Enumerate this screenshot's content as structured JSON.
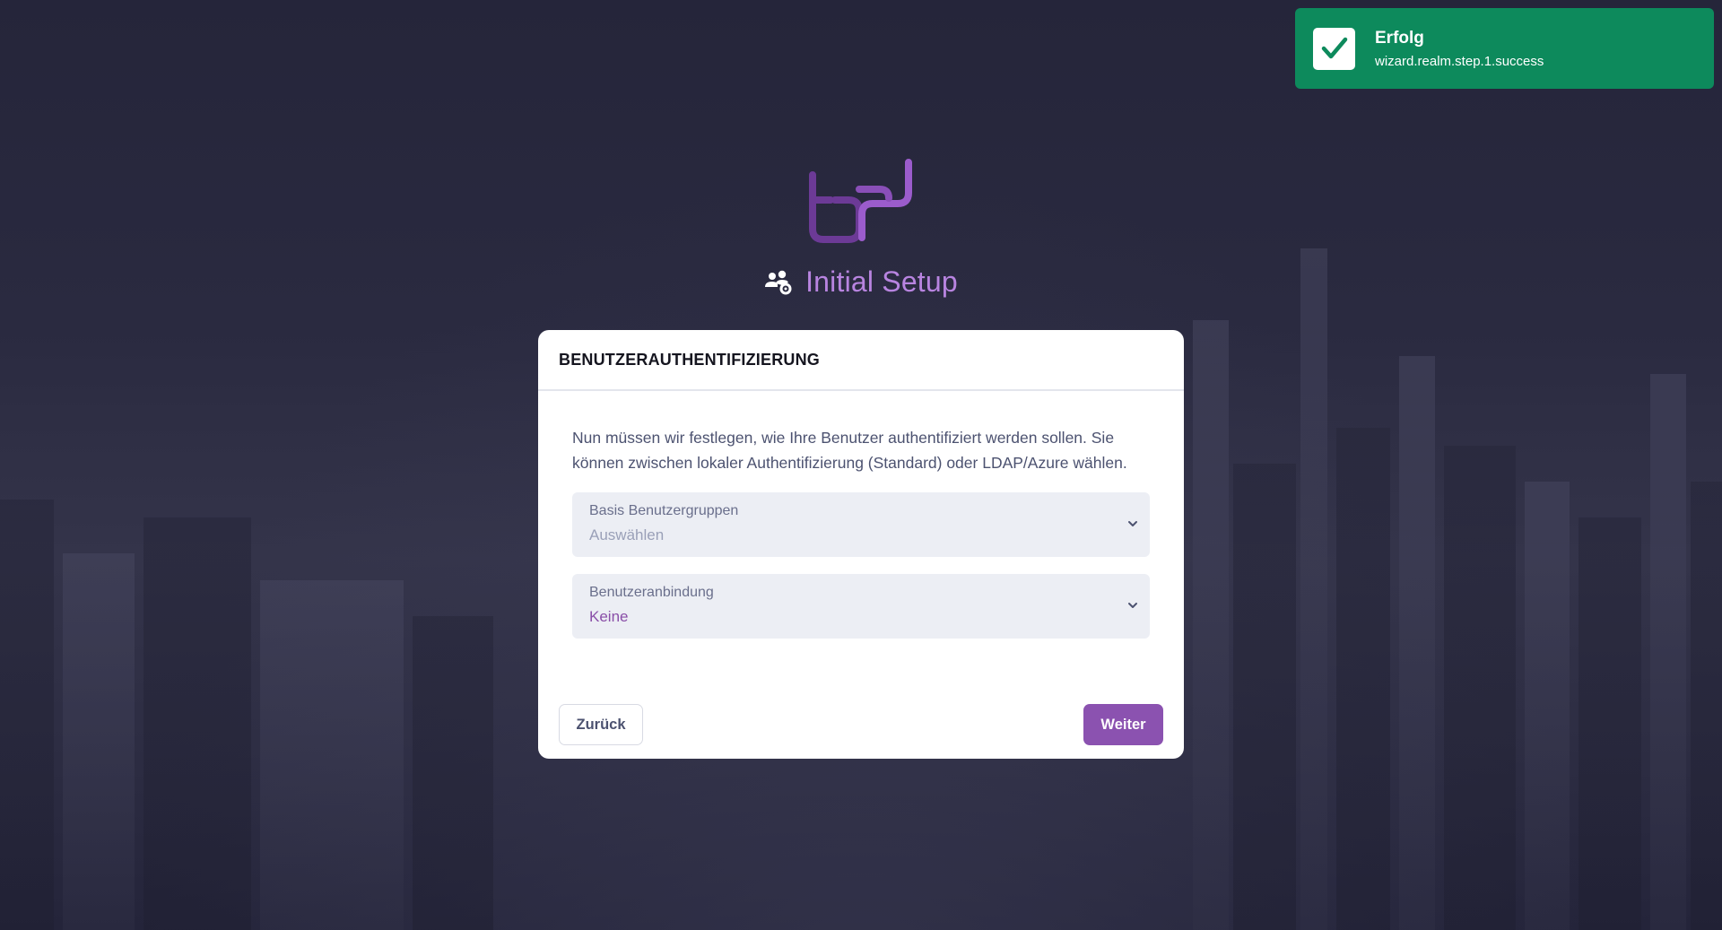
{
  "toast": {
    "title": "Erfolg",
    "message": "wizard.realm.step.1.success",
    "icon": "check-icon",
    "color": "#0d8a5c"
  },
  "header": {
    "title": "Initial Setup",
    "icon": "users-gear-icon",
    "accent": "#b884e0"
  },
  "card": {
    "title": "BENUTZERAUTHENTIFIZIERUNG",
    "intro": "Nun müssen wir festlegen, wie Ihre Benutzer authentifiziert werden sollen. Sie können zwischen lokaler Authentifizierung (Standard) oder LDAP/Azure wählen.",
    "fields": [
      {
        "label": "Basis Benutzergruppen",
        "value": "Auswählen"
      },
      {
        "label": "Benutzeranbindung",
        "value": "Keine"
      }
    ],
    "back_label": "Zurück",
    "next_label": "Weiter",
    "primary_color": "#8b52b0"
  }
}
